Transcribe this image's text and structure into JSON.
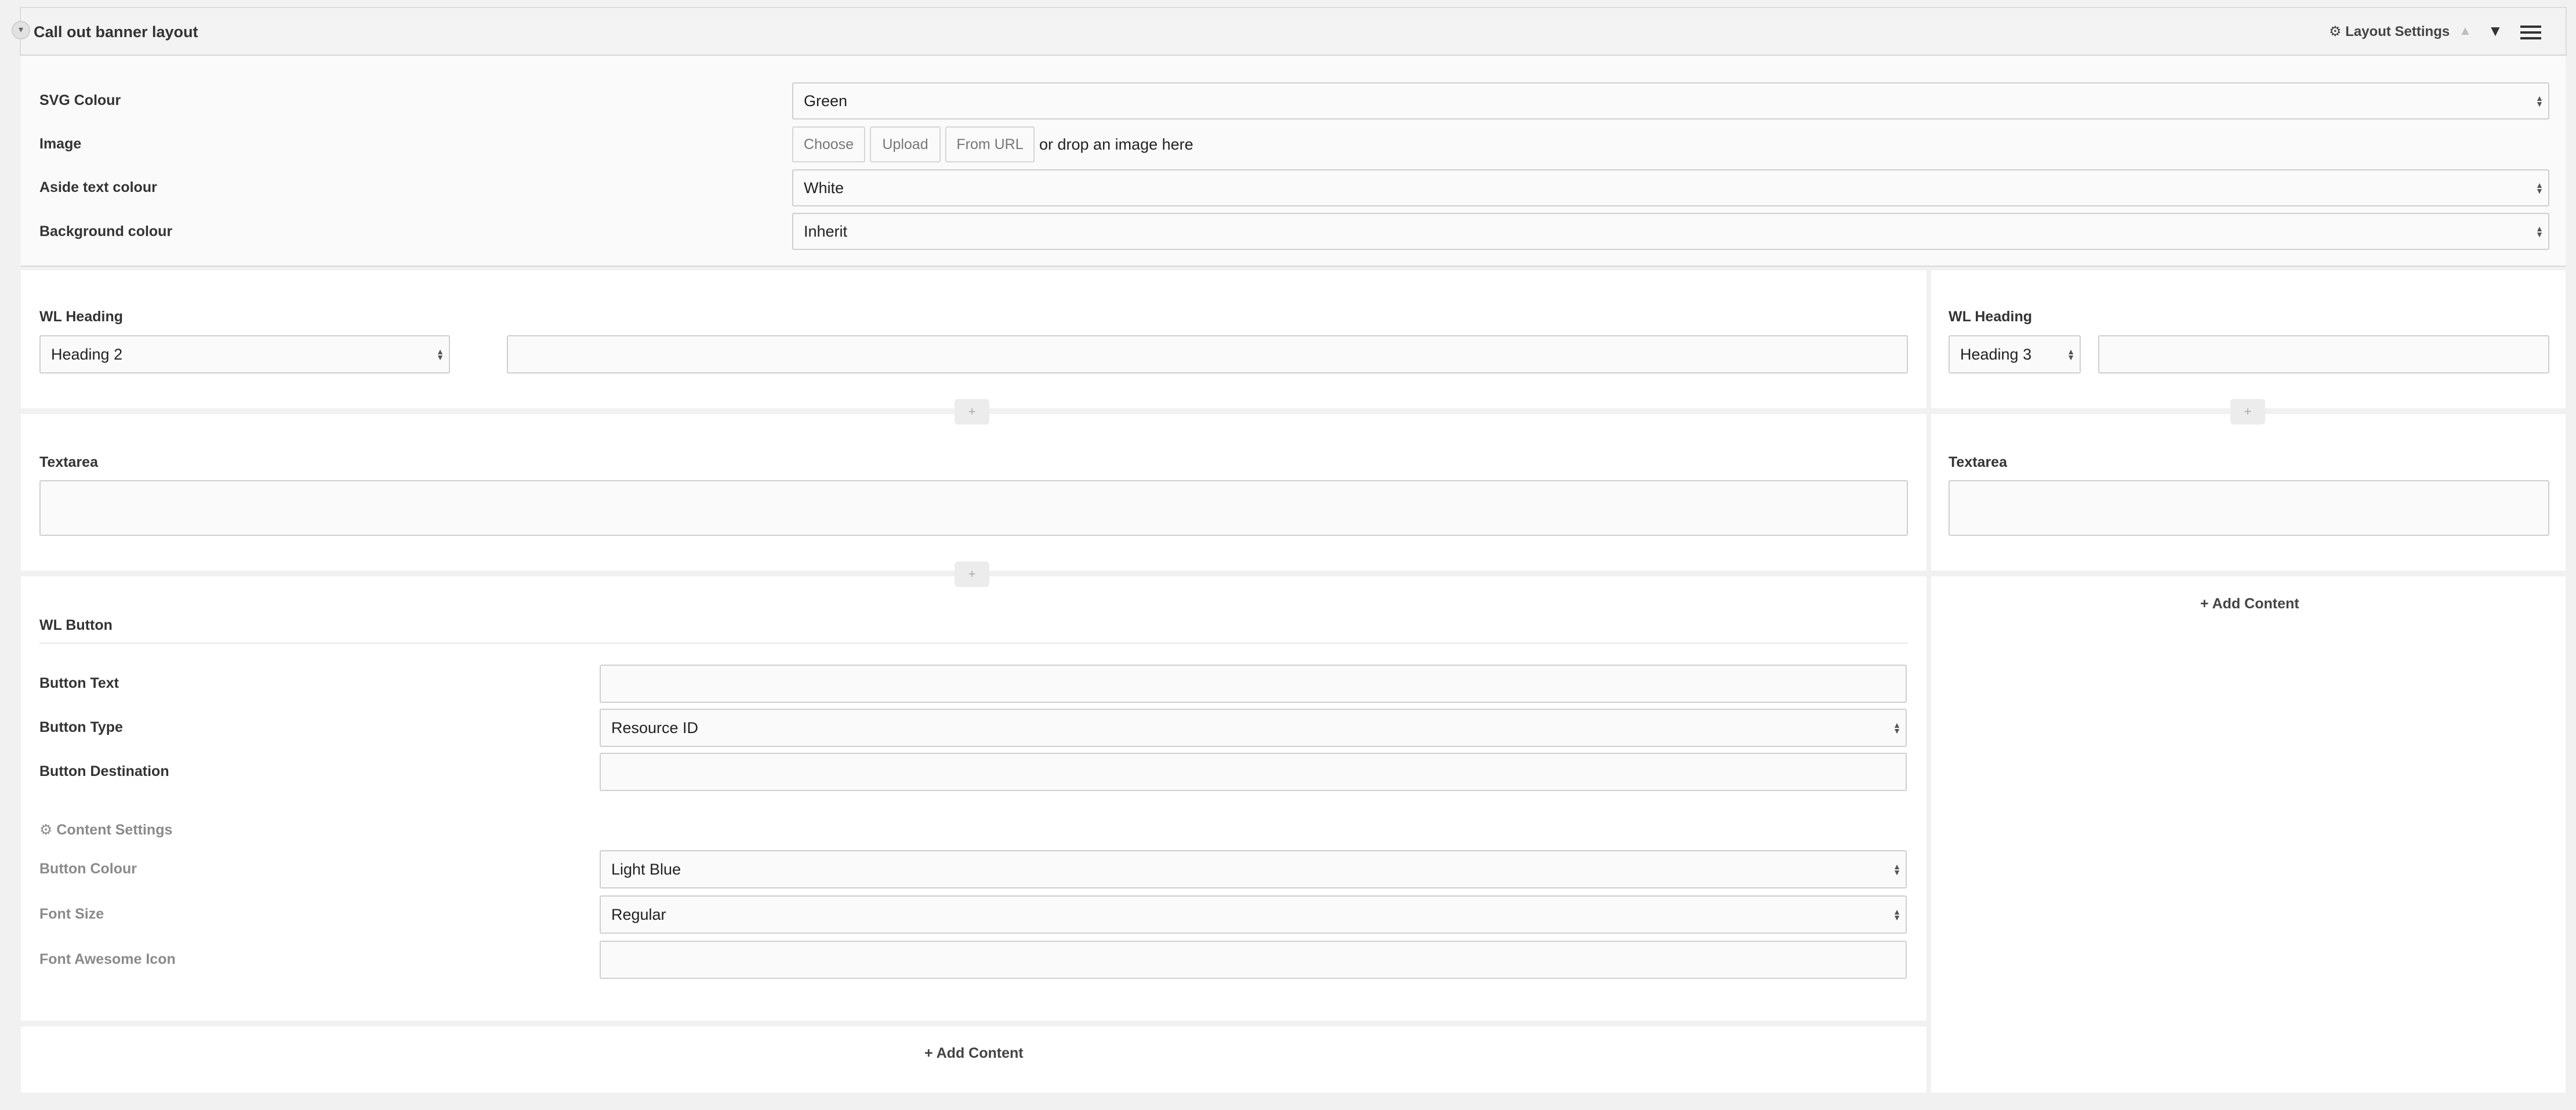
{
  "header": {
    "title": "Call out banner layout",
    "layout_settings": "Layout Settings",
    "gear_glyph": "⚙",
    "collapse_glyph": "▾",
    "up_glyph": "▲",
    "down_glyph": "▼"
  },
  "settings": {
    "svg_colour": {
      "label": "SVG Colour",
      "value": "Green"
    },
    "image": {
      "label": "Image",
      "buttons": [
        "Choose",
        "Upload",
        "From URL"
      ],
      "drop_text": "or drop an image here"
    },
    "aside_text_colour": {
      "label": "Aside text colour",
      "value": "White"
    },
    "background_colour": {
      "label": "Background colour",
      "value": "Inherit"
    }
  },
  "left_column": {
    "heading": {
      "label": "WL Heading",
      "level": "Heading 2",
      "text": ""
    },
    "textarea": {
      "label": "Textarea",
      "value": ""
    },
    "button": {
      "title": "WL Button",
      "button_text": {
        "label": "Button Text",
        "value": ""
      },
      "button_type": {
        "label": "Button Type",
        "value": "Resource ID"
      },
      "button_destination": {
        "label": "Button Destination",
        "value": ""
      },
      "content_settings": "Content Settings",
      "button_colour": {
        "label": "Button Colour",
        "value": "Light Blue"
      },
      "font_size": {
        "label": "Font Size",
        "value": "Regular"
      },
      "font_awesome_icon": {
        "label": "Font Awesome Icon",
        "value": ""
      }
    },
    "add_content": "+ Add Content"
  },
  "right_column": {
    "heading": {
      "label": "WL Heading",
      "level": "Heading 3",
      "text": ""
    },
    "textarea": {
      "label": "Textarea",
      "value": ""
    },
    "add_content": "+ Add Content"
  },
  "plus_glyph": "+",
  "caret_up": "▲",
  "caret_down": "▼"
}
